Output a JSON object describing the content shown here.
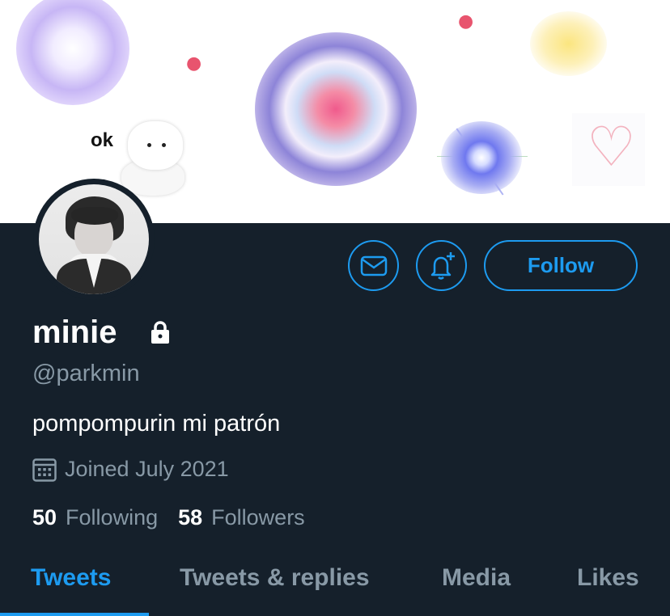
{
  "banner": {
    "sticker_text": "ok"
  },
  "profile": {
    "display_name": "minie",
    "handle": "@parkmin",
    "bio": "pompompurin mi patrón",
    "joined": "Joined July 2021",
    "protected": true
  },
  "actions": {
    "follow_label": "Follow",
    "message_icon": "mail-icon",
    "notify_icon": "bell-plus-icon"
  },
  "stats": {
    "following_count": "50",
    "following_label": "Following",
    "followers_count": "58",
    "followers_label": "Followers"
  },
  "tabs": [
    {
      "label": "Tweets",
      "active": true
    },
    {
      "label": "Tweets & replies",
      "active": false
    },
    {
      "label": "Media",
      "active": false
    },
    {
      "label": "Likes",
      "active": false
    }
  ],
  "colors": {
    "background": "#15202b",
    "accent": "#1d9bf0",
    "secondary_text": "#8899a6"
  }
}
